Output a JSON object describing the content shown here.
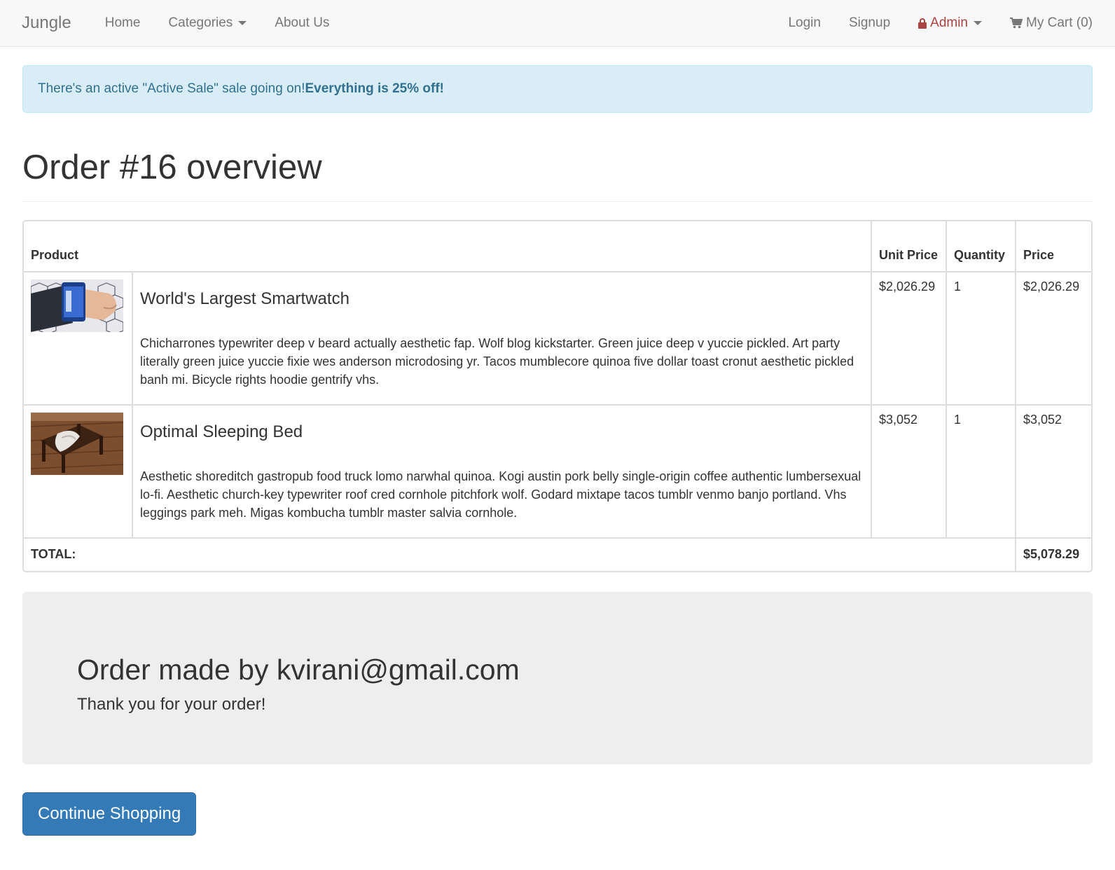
{
  "navbar": {
    "brand": "Jungle",
    "home": "Home",
    "categories": "Categories",
    "about": "About Us",
    "login": "Login",
    "signup": "Signup",
    "admin": "Admin",
    "cart": "My Cart (0)"
  },
  "alert": {
    "text": "There's an active \"Active Sale\" sale going on! ",
    "emphasis": "Everything is 25% off!"
  },
  "page": {
    "title": "Order #16 overview"
  },
  "table": {
    "headers": {
      "product": "Product",
      "unit_price": "Unit Price",
      "quantity": "Quantity",
      "price": "Price"
    },
    "rows": [
      {
        "name": "World's Largest Smartwatch",
        "description": "Chicharrones typewriter deep v beard actually aesthetic fap. Wolf blog kickstarter. Green juice deep v yuccie pickled. Art party literally green juice yuccie fixie wes anderson microdosing yr. Tacos mumblecore quinoa five dollar toast cronut aesthetic pickled banh mi. Bicycle rights hoodie gentrify vhs.",
        "unit_price": "$2,026.29",
        "quantity": "1",
        "price": "$2,026.29"
      },
      {
        "name": "Optimal Sleeping Bed",
        "description": "Aesthetic shoreditch gastropub food truck lomo narwhal quinoa. Kogi austin pork belly single-origin coffee authentic lumbersexual lo-fi. Aesthetic church-key typewriter roof cred cornhole pitchfork wolf. Godard mixtape tacos tumblr venmo banjo portland. Vhs leggings park meh. Migas kombucha tumblr master salvia cornhole.",
        "unit_price": "$3,052",
        "quantity": "1",
        "price": "$3,052"
      }
    ],
    "total_label": "TOTAL:",
    "total_value": "$5,078.29"
  },
  "jumbotron": {
    "heading": "Order made by kvirani@gmail.com",
    "subheading": "Thank you for your order!"
  },
  "actions": {
    "continue_label": "Continue Shopping"
  }
}
